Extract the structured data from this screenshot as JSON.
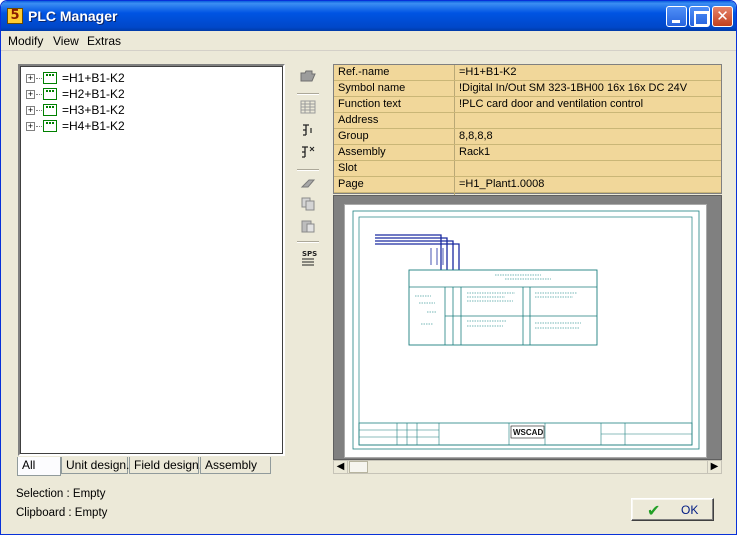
{
  "window": {
    "title": "PLC Manager",
    "icon_glyph": "5"
  },
  "menu": [
    "Modify",
    "View",
    "Extras"
  ],
  "tree": {
    "items": [
      "=H1+B1-K2",
      "=H2+B1-K2",
      "=H3+B1-K2",
      "=H4+B1-K2"
    ]
  },
  "tabs": [
    "All",
    "Unit design.",
    "Field design.",
    "Assembly"
  ],
  "status": {
    "selection": "Selection : Empty",
    "clipboard": "Clipboard : Empty"
  },
  "toolbar": {
    "icons": [
      "folder-open-icon",
      "table-icon",
      "tree-one-icon",
      "tree-x-icon",
      "eraser-icon",
      "copy-icon",
      "paste-icon",
      "sps-icon"
    ],
    "sps_label": "SPS"
  },
  "properties": [
    {
      "key": "Ref.-name",
      "value": "=H1+B1-K2"
    },
    {
      "key": "Symbol name",
      "value": "!Digital In/Out SM 323-1BH00 16x 16x DC 24V"
    },
    {
      "key": "Function text",
      "value": "!PLC card door and ventilation control"
    },
    {
      "key": "Address",
      "value": ""
    },
    {
      "key": "Group",
      "value": "8,8,8,8"
    },
    {
      "key": "Assembly",
      "value": "Rack1"
    },
    {
      "key": "Slot",
      "value": ""
    },
    {
      "key": "Page",
      "value": "=H1_Plant1.0008"
    }
  ],
  "preview": {
    "logo_text": "WSCAD"
  },
  "ok_button": {
    "label": "OK"
  },
  "colors": {
    "title_blue": "#0054e3",
    "props_bg": "#f1d79a",
    "tree_icon_green": "#008000",
    "schematic_teal": "#1c7f7f"
  }
}
